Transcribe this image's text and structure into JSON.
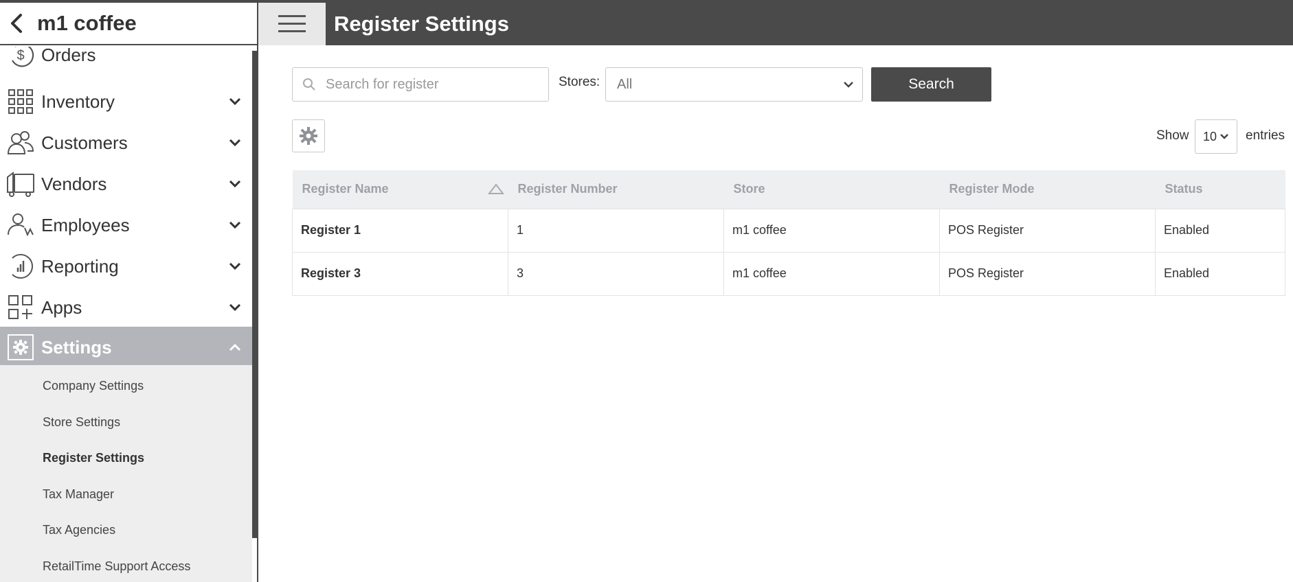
{
  "app": {
    "company_name": "m1 coffee"
  },
  "header": {
    "title": "Register Settings"
  },
  "sidebar": {
    "items": [
      {
        "label": "Orders",
        "icon": "dollar-circle-icon"
      },
      {
        "label": "Inventory",
        "icon": "grid-icon"
      },
      {
        "label": "Customers",
        "icon": "users-icon"
      },
      {
        "label": "Vendors",
        "icon": "truck-icon"
      },
      {
        "label": "Employees",
        "icon": "employee-icon"
      },
      {
        "label": "Reporting",
        "icon": "chart-circle-icon"
      },
      {
        "label": "Apps",
        "icon": "apps-plus-icon"
      },
      {
        "label": "Settings",
        "icon": "gear-icon"
      }
    ],
    "settings_sub": [
      "Company Settings",
      "Store Settings",
      "Register Settings",
      "Tax Manager",
      "Tax Agencies",
      "RetailTime Support Access"
    ]
  },
  "filters": {
    "search_placeholder": "Search for register",
    "stores_label": "Stores:",
    "stores_value": "All",
    "search_button": "Search"
  },
  "pagination": {
    "show_label": "Show",
    "entries_value": "10",
    "entries_label": "entries"
  },
  "table": {
    "columns": [
      "Register Name",
      "Register Number",
      "Store",
      "Register Mode",
      "Status"
    ],
    "rows": [
      {
        "name": "Register 1",
        "number": "1",
        "store": "m1 coffee",
        "mode": "POS Register",
        "status": "Enabled"
      },
      {
        "name": "Register 3",
        "number": "3",
        "store": "m1 coffee",
        "mode": "POS Register",
        "status": "Enabled"
      }
    ]
  },
  "colors": {
    "dark": "#4a4a4a",
    "active_nav": "#b3b5ba",
    "submenu_bg": "#eeeeee",
    "table_header_bg": "#eeeff1"
  }
}
